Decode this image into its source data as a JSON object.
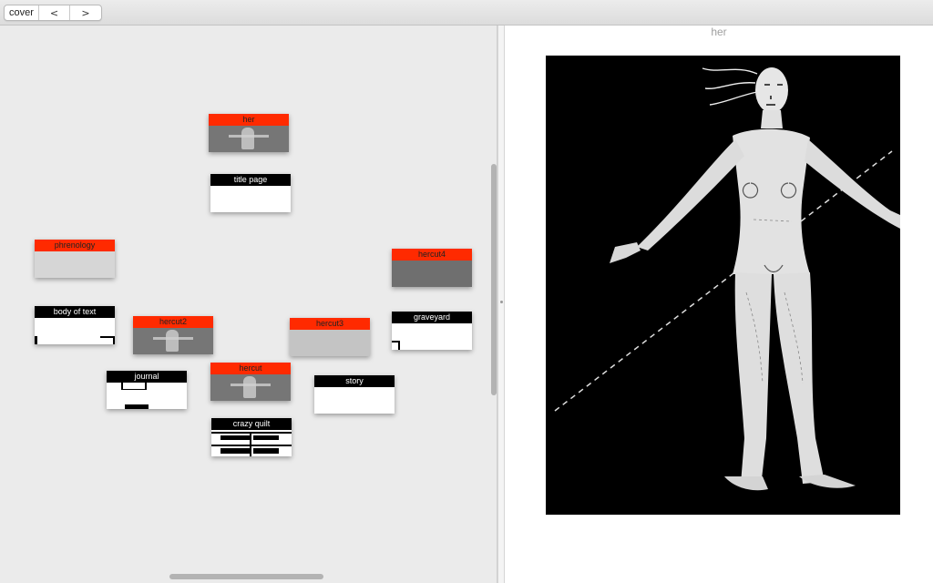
{
  "toolbar": {
    "title": "cover",
    "back_label": "<",
    "forward_label": ">"
  },
  "canvas": {
    "nodes": [
      {
        "id": "her",
        "label": "her",
        "kind": "image"
      },
      {
        "id": "title-page",
        "label": "title page",
        "kind": "text"
      },
      {
        "id": "phrenology",
        "label": "phrenology",
        "kind": "image"
      },
      {
        "id": "hercut4",
        "label": "hercut4",
        "kind": "image"
      },
      {
        "id": "body-of-text",
        "label": "body of text",
        "kind": "text"
      },
      {
        "id": "hercut2",
        "label": "hercut2",
        "kind": "image"
      },
      {
        "id": "hercut3",
        "label": "hercut3",
        "kind": "image"
      },
      {
        "id": "graveyard",
        "label": "graveyard",
        "kind": "text"
      },
      {
        "id": "journal",
        "label": "journal",
        "kind": "text"
      },
      {
        "id": "hercut",
        "label": "hercut",
        "kind": "image"
      },
      {
        "id": "story",
        "label": "story",
        "kind": "text"
      },
      {
        "id": "crazy-quilt",
        "label": "crazy quilt",
        "kind": "text"
      }
    ]
  },
  "preview": {
    "title": "her"
  },
  "colors": {
    "image_node_header": "#ff2a00",
    "text_node_header": "#000000",
    "canvas_background": "#ebebeb"
  },
  "icons": {
    "back": "chevron-left-icon",
    "forward": "chevron-right-icon"
  }
}
